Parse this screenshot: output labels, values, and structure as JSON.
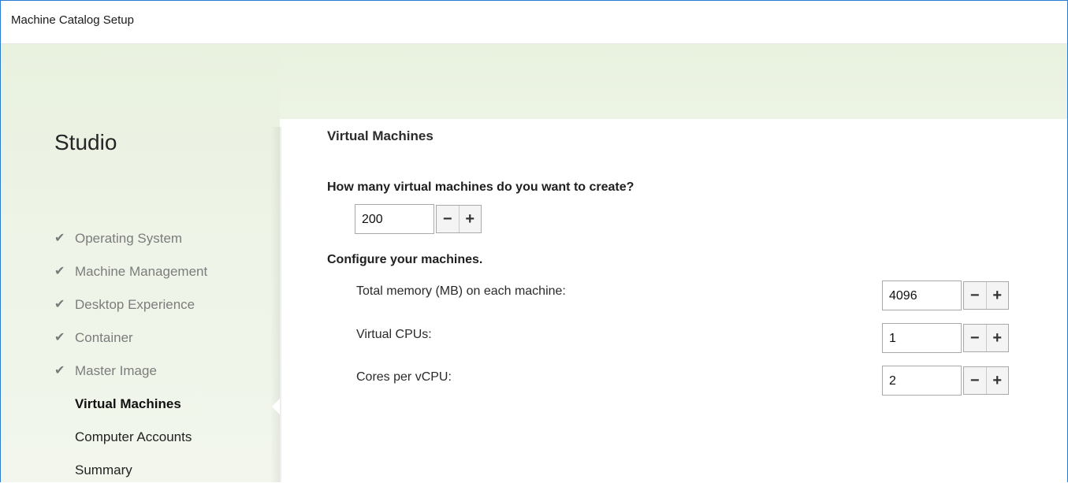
{
  "window": {
    "title": "Machine Catalog Setup"
  },
  "sidebar": {
    "brand": "Studio",
    "steps": [
      {
        "label": "Operating System",
        "state": "done"
      },
      {
        "label": "Machine Management",
        "state": "done"
      },
      {
        "label": "Desktop Experience",
        "state": "done"
      },
      {
        "label": "Container",
        "state": "done"
      },
      {
        "label": "Master Image",
        "state": "done"
      },
      {
        "label": "Virtual Machines",
        "state": "current"
      },
      {
        "label": "Computer Accounts",
        "state": "pending"
      },
      {
        "label": "Summary",
        "state": "pending"
      }
    ],
    "check_glyph": "✔"
  },
  "main": {
    "heading": "Virtual Machines",
    "question": "How many virtual machines do you want to create?",
    "vm_count": "200",
    "configure": "Configure your machines.",
    "fields": [
      {
        "label": "Total memory (MB) on each machine:",
        "value": "4096"
      },
      {
        "label": "Virtual CPUs:",
        "value": "1"
      },
      {
        "label": "Cores per vCPU:",
        "value": "2"
      }
    ],
    "minus": "−",
    "plus": "+"
  }
}
